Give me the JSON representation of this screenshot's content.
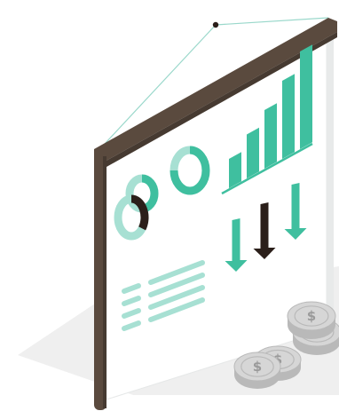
{
  "illustration": {
    "subject": "presentation-board-with-analytics-and-coins",
    "colors": {
      "frame": "#5a4a3e",
      "frame_dark": "#463a31",
      "board": "#ffffff",
      "board_shadow": "#eef0f0",
      "floor_shadow": "#ececec",
      "teal": "#3fbf9f",
      "teal_light": "#a7e0d3",
      "dark": "#2b1f1a",
      "string": "#9ad8cb",
      "coin": "#d6d6d6",
      "coin_edge": "#b9b9b9",
      "coin_symbol": "#9a9a9a"
    },
    "elements": {
      "bars": {
        "count": 5,
        "relative_heights": [
          0.3,
          0.45,
          0.6,
          0.8,
          1.0
        ]
      },
      "arrows": [
        {
          "direction": "down",
          "color": "teal"
        },
        {
          "direction": "down",
          "color": "dark"
        },
        {
          "direction": "down",
          "color": "teal"
        }
      ],
      "donuts": [
        {
          "fill_color": "dark",
          "fill_fraction": 0.35
        },
        {
          "fill_color": "teal",
          "fill_fraction": 0.75
        },
        {
          "fill_color": "teal",
          "fill_fraction": 0.5
        }
      ],
      "list_rows": 4,
      "coins": 4
    }
  }
}
